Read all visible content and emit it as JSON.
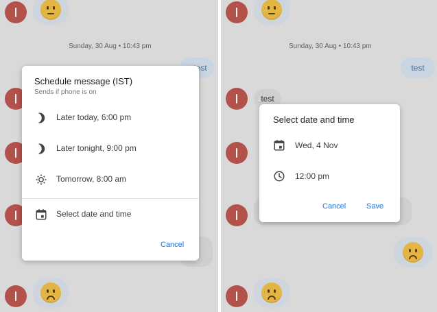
{
  "left_screen": {
    "timestamp": "Sunday, 30 Aug • 10:43 pm",
    "sent_message": "test",
    "dialog": {
      "title": "Schedule message (IST)",
      "subtitle": "Sends if phone is on",
      "options": [
        {
          "label": "Later today, 6:00 pm",
          "icon": "moon-icon"
        },
        {
          "label": "Later tonight, 9:00 pm",
          "icon": "moon-icon"
        },
        {
          "label": "Tomorrow, 8:00 am",
          "icon": "sun-gear-icon"
        },
        {
          "label": "Select date and time",
          "icon": "calendar-icon"
        }
      ],
      "cancel_label": "Cancel"
    }
  },
  "right_screen": {
    "timestamp": "Sunday, 30 Aug • 10:43 pm",
    "sent_message": "test",
    "received_message": "test",
    "dialog": {
      "title": "Select date and time",
      "date": "Wed, 4 Nov",
      "time": "12:00 pm",
      "cancel_label": "Cancel",
      "save_label": "Save"
    }
  },
  "colors": {
    "accent": "#1a73e8",
    "avatar": "#b3514b",
    "backdrop": "#d9d9d9",
    "sent_bubble": "#c9d5e1"
  }
}
